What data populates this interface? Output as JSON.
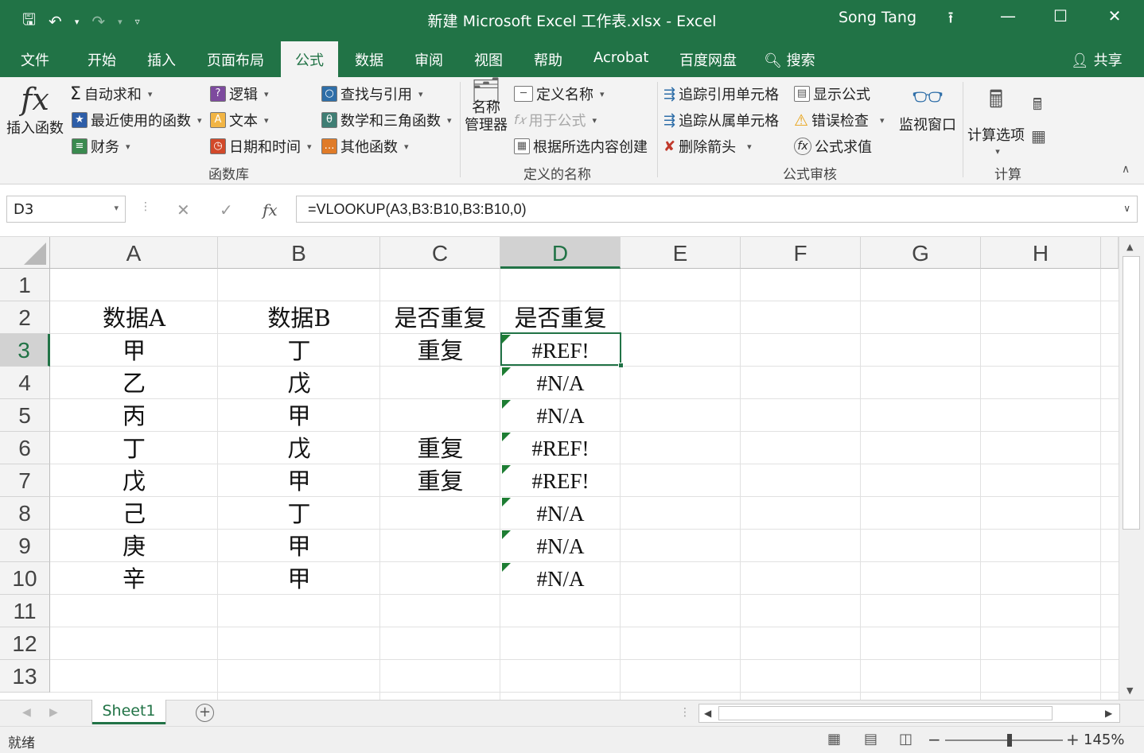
{
  "window": {
    "title": "新建 Microsoft Excel 工作表.xlsx  -  Excel",
    "user": "Song Tang"
  },
  "quick_access": {
    "save_icon": "save-icon",
    "undo_icon": "undo-icon",
    "redo_icon": "redo-icon"
  },
  "menu": {
    "tabs": [
      "文件",
      "开始",
      "插入",
      "页面布局",
      "公式",
      "数据",
      "审阅",
      "视图",
      "帮助",
      "Acrobat",
      "百度网盘",
      "搜索"
    ],
    "active": "公式",
    "share": "共享"
  },
  "ribbon": {
    "insert_function": "插入函数",
    "autosum": "自动求和",
    "recently_used": "最近使用的函数",
    "financial": "财务",
    "logical": "逻辑",
    "text": "文本",
    "datetime": "日期和时间",
    "lookup": "查找与引用",
    "math": "数学和三角函数",
    "more_functions": "其他函数",
    "group_library": "函数库",
    "name_manager_1": "名称",
    "name_manager_2": "管理器",
    "define_name": "定义名称",
    "use_in_formula": "用于公式",
    "create_from_selection": "根据所选内容创建",
    "group_defined_names": "定义的名称",
    "trace_precedents": "追踪引用单元格",
    "trace_dependents": "追踪从属单元格",
    "remove_arrows": "删除箭头",
    "show_formulas": "显示公式",
    "error_checking": "错误检查",
    "evaluate_formula": "公式求值",
    "group_auditing": "公式审核",
    "watch_window": "监视窗口",
    "calc_options": "计算选项",
    "group_calculation": "计算"
  },
  "formula_bar": {
    "name_box": "D3",
    "formula": "=VLOOKUP(A3,B3:B10,B3:B10,0)"
  },
  "sheet": {
    "columns": [
      "A",
      "B",
      "C",
      "D",
      "E",
      "F",
      "G",
      "H"
    ],
    "selected_column": "D",
    "selected_row": "3",
    "rows": [
      {
        "num": "1",
        "A": "",
        "B": "",
        "C": "",
        "D": ""
      },
      {
        "num": "2",
        "A": "数据A",
        "B": "数据B",
        "C": "是否重复",
        "D": "是否重复"
      },
      {
        "num": "3",
        "A": "甲",
        "B": "丁",
        "C": "重复",
        "D": "#REF!"
      },
      {
        "num": "4",
        "A": "乙",
        "B": "戊",
        "C": "",
        "D": "#N/A"
      },
      {
        "num": "5",
        "A": "丙",
        "B": "甲",
        "C": "",
        "D": "#N/A"
      },
      {
        "num": "6",
        "A": "丁",
        "B": "戊",
        "C": "重复",
        "D": "#REF!"
      },
      {
        "num": "7",
        "A": "戊",
        "B": "甲",
        "C": "重复",
        "D": "#REF!"
      },
      {
        "num": "8",
        "A": "己",
        "B": "丁",
        "C": "",
        "D": "#N/A"
      },
      {
        "num": "9",
        "A": "庚",
        "B": "甲",
        "C": "",
        "D": "#N/A"
      },
      {
        "num": "10",
        "A": "辛",
        "B": "甲",
        "C": "",
        "D": "#N/A"
      },
      {
        "num": "11",
        "A": "",
        "B": "",
        "C": "",
        "D": ""
      },
      {
        "num": "12",
        "A": "",
        "B": "",
        "C": "",
        "D": ""
      },
      {
        "num": "13",
        "A": "",
        "B": "",
        "C": "",
        "D": ""
      }
    ],
    "error_flag_rows": [
      "3",
      "4",
      "5",
      "6",
      "7",
      "8",
      "9",
      "10"
    ]
  },
  "sheet_tabs": {
    "active": "Sheet1"
  },
  "status": {
    "ready": "就绪",
    "zoom": "145%"
  },
  "colors": {
    "accent": "#217346",
    "ribbon_bg": "#f3f3f3",
    "error_flag": "#1d7d33"
  }
}
